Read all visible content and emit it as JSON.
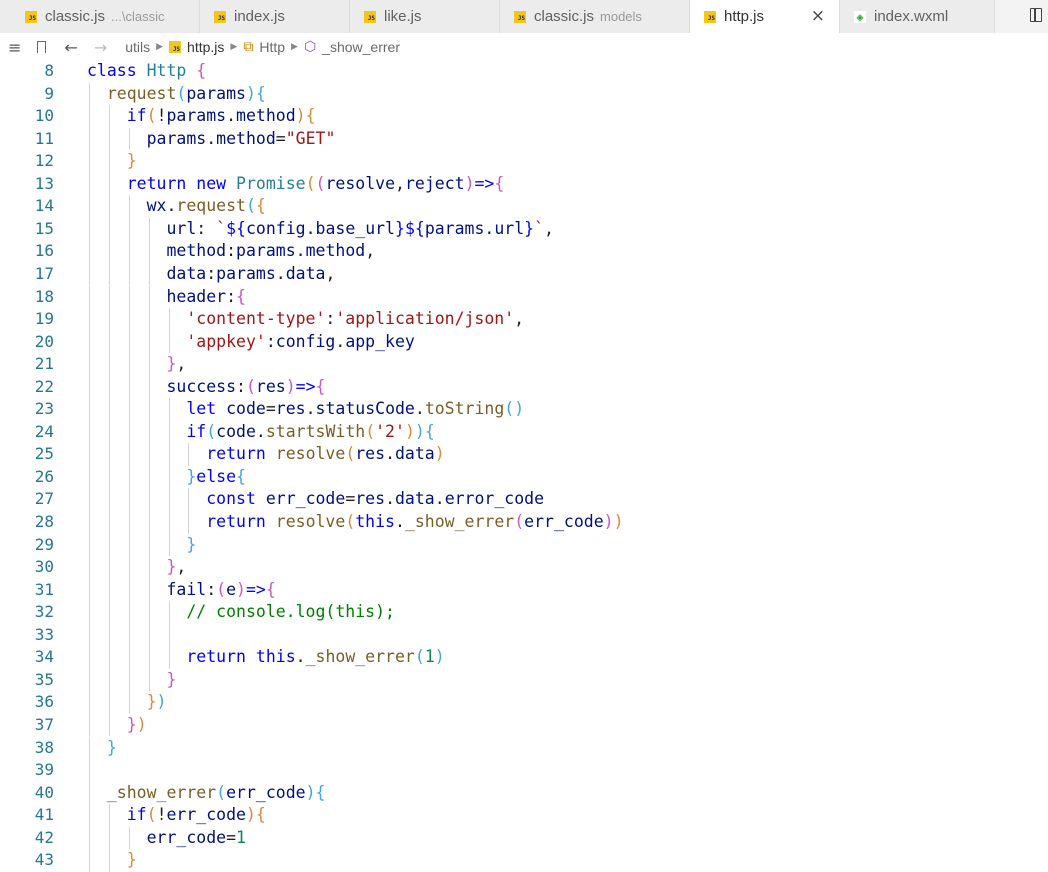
{
  "tabs": [
    {
      "name": "classic.js",
      "desc": "...\\classic",
      "icon": "js-file-icon",
      "active": false
    },
    {
      "name": "index.js",
      "desc": "",
      "icon": "js-file-icon",
      "active": false
    },
    {
      "name": "like.js",
      "desc": "",
      "icon": "js-file-icon",
      "active": false
    },
    {
      "name": "classic.js",
      "desc": "models",
      "icon": "js-file-icon",
      "active": false
    },
    {
      "name": "http.js",
      "desc": "",
      "icon": "js-file-icon",
      "active": true
    },
    {
      "name": "index.wxml",
      "desc": "",
      "icon": "wxml-file-icon",
      "active": false
    }
  ],
  "tab_close": "×",
  "breadcrumb": {
    "folder": "utils",
    "file": "http.js",
    "class": "Http",
    "method": "_show_errer"
  },
  "line_numbers": [
    "8",
    "9",
    "10",
    "11",
    "12",
    "13",
    "14",
    "15",
    "16",
    "17",
    "18",
    "19",
    "20",
    "21",
    "22",
    "23",
    "24",
    "25",
    "26",
    "27",
    "28",
    "29",
    "30",
    "31",
    "32",
    "33",
    "34",
    "35",
    "36",
    "37",
    "38",
    "39",
    "40",
    "41",
    "42",
    "43"
  ],
  "code_lines": [
    "class Http {",
    "  request(params){",
    "    if(!params.method){",
    "      params.method=\"GET\"",
    "    }",
    "    return new Promise((resolve,reject)=>{",
    "      wx.request({",
    "        url: `${config.base_url}${params.url}`,",
    "        method:params.method,",
    "        data:params.data,",
    "        header:{",
    "          'content-type':'application/json',",
    "          'appkey':config.app_key",
    "        },",
    "        success:(res)=>{",
    "          let code=res.statusCode.toString()",
    "          if(code.startsWith('2')){",
    "            return resolve(res.data)",
    "          }else{",
    "            const err_code=res.data.error_code",
    "            return resolve(this._show_errer(err_code))",
    "          }",
    "        },",
    "        fail:(e)=>{",
    "          // console.log(this);",
    "",
    "          return this._show_errer(1)",
    "        }",
    "      })",
    "    })",
    "  }",
    "",
    "  _show_errer(err_code){",
    "    if(!err_code){",
    "      err_code=1",
    "    }"
  ]
}
